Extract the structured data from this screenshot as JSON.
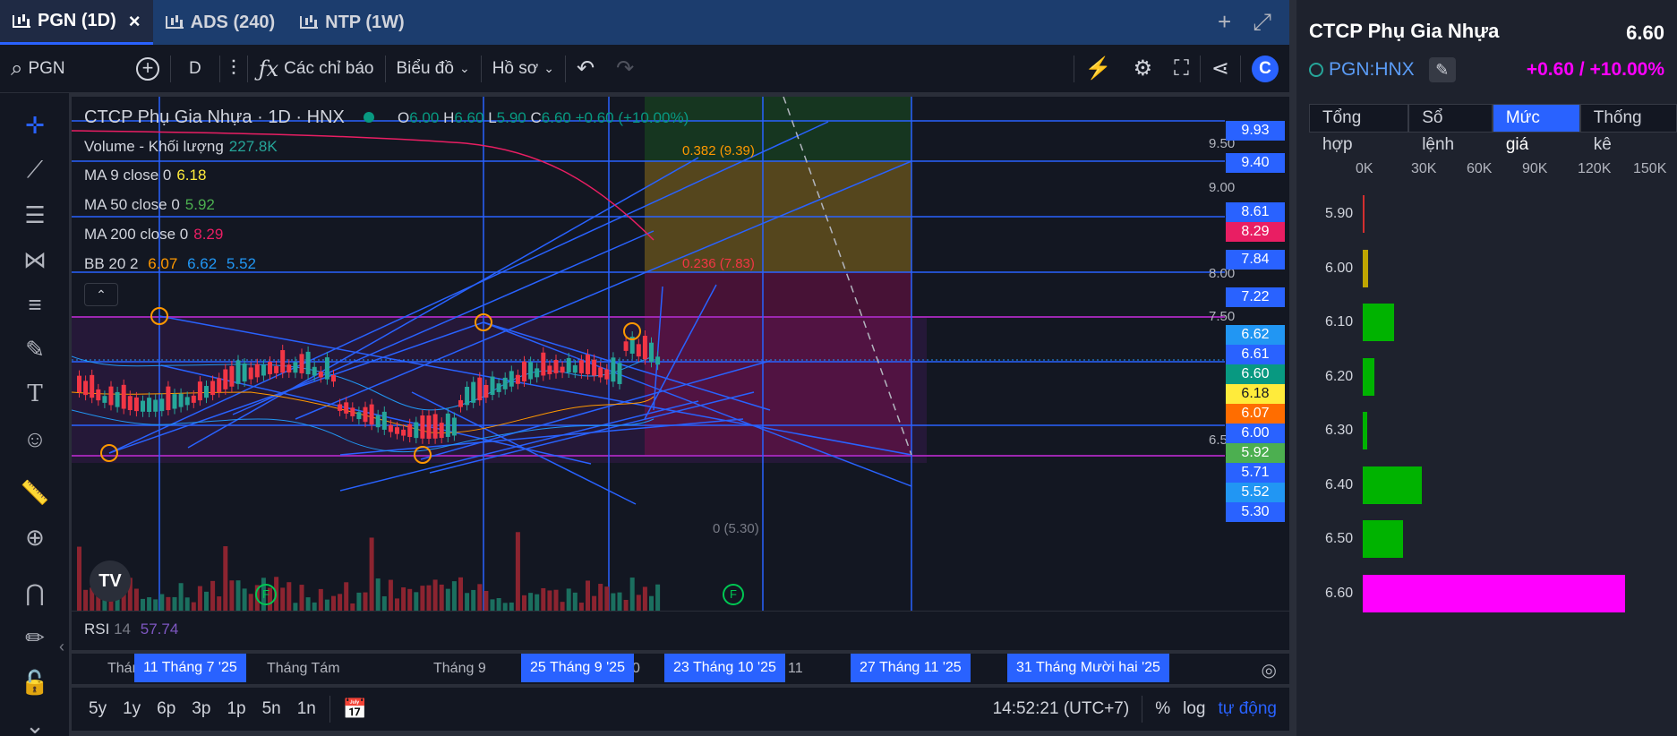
{
  "tabs": [
    {
      "label": "PGN (1D)",
      "active": true
    },
    {
      "label": "ADS (240)",
      "active": false
    },
    {
      "label": "NTP (1W)",
      "active": false
    }
  ],
  "tab_actions": {
    "add": "+",
    "expand": "⤢"
  },
  "toolbar": {
    "symbol": "PGN",
    "interval": "D",
    "indicators_label": "Các chỉ báo",
    "chart_type_label": "Biểu đồ",
    "profile_label": "Hồ sơ"
  },
  "legend": {
    "title": "CTCP Phụ Gia Nhựa · 1D · HNX",
    "ohlc": {
      "o_label": "O",
      "o": "6.00",
      "h_label": "H",
      "h": "6.60",
      "l_label": "L",
      "l": "5.90",
      "c_label": "C",
      "c": "6.60",
      "change": "+0.60 (+10.00%)"
    },
    "volume_label": "Volume - Khối lượng",
    "volume_value": "227.8K",
    "ma9_label": "MA 9 close 0",
    "ma9_value": "6.18",
    "ma50_label": "MA 50 close 0",
    "ma50_value": "5.92",
    "ma200_label": "MA 200 close 0",
    "ma200_value": "8.29",
    "bb_label": "BB 20 2",
    "bb_basis": "6.07",
    "bb_upper": "6.62",
    "bb_lower": "5.52"
  },
  "fib_labels": {
    "f382": "0.382 (9.39)",
    "f236": "0.236 (7.83)",
    "f0": "0 (5.30)"
  },
  "price_axis": {
    "ticks": [
      "9.50",
      "9.00",
      "8.00",
      "7.50",
      "6.50"
    ],
    "labels": [
      {
        "text": "9.93",
        "color": "#2962ff"
      },
      {
        "text": "9.40",
        "color": "#2962ff"
      },
      {
        "text": "8.61",
        "color": "#2962ff"
      },
      {
        "text": "8.29",
        "color": "#e91e63"
      },
      {
        "text": "7.84",
        "color": "#2962ff"
      },
      {
        "text": "7.22",
        "color": "#2962ff"
      },
      {
        "text": "6.62",
        "color": "#2196f3"
      },
      {
        "text": "6.61",
        "color": "#2962ff"
      },
      {
        "text": "6.60",
        "color": "#089981"
      },
      {
        "text": "6.18",
        "color": "#ffeb3b"
      },
      {
        "text": "6.07",
        "color": "#ff6d00"
      },
      {
        "text": "6.00",
        "color": "#2962ff"
      },
      {
        "text": "5.92",
        "color": "#4caf50"
      },
      {
        "text": "5.71",
        "color": "#2962ff"
      },
      {
        "text": "5.52",
        "color": "#2196f3"
      },
      {
        "text": "5.30",
        "color": "#2962ff"
      }
    ]
  },
  "rsi": {
    "label": "RSI",
    "period": "14",
    "value": "57.74"
  },
  "time_axis": {
    "labels": [
      "Thán",
      "Tháng Tám",
      "Tháng 9",
      "0",
      "11"
    ],
    "selected": [
      "11 Tháng 7 '25",
      "25 Tháng 9 '25",
      "23 Tháng 10 '25",
      "27 Tháng 11 '25",
      "31 Tháng Mười hai '25"
    ]
  },
  "ranges": [
    "5y",
    "1y",
    "6p",
    "3p",
    "1p",
    "5n",
    "1n"
  ],
  "bottom_right": {
    "clock": "14:52:21 (UTC+7)",
    "percent": "%",
    "log": "log",
    "auto": "tự động"
  },
  "panel": {
    "company": "CTCP Phụ Gia Nhựa",
    "price": "6.60",
    "symbol": "PGN:HNX",
    "change": "+0.60 / +10.00%",
    "tabs": [
      "Tổng hợp",
      "Sổ lệnh",
      "Mức giá",
      "Thống kê"
    ],
    "active_tab": "Mức giá",
    "xaxis": [
      "0K",
      "30K",
      "60K",
      "90K",
      "120K",
      "150K"
    ],
    "volume_by_price": [
      {
        "price": "5.90",
        "volume": 200,
        "color": "#d32f2f"
      },
      {
        "price": "6.00",
        "volume": 3000,
        "color": "#bfa500"
      },
      {
        "price": "6.10",
        "volume": 17000,
        "color": "#00b300"
      },
      {
        "price": "6.20",
        "volume": 6500,
        "color": "#00b300"
      },
      {
        "price": "6.30",
        "volume": 2500,
        "color": "#00b300"
      },
      {
        "price": "6.40",
        "volume": 32000,
        "color": "#00b300"
      },
      {
        "price": "6.50",
        "volume": 22000,
        "color": "#00b300"
      },
      {
        "price": "6.60",
        "volume": 142000,
        "color": "#ff00ff"
      }
    ]
  }
}
